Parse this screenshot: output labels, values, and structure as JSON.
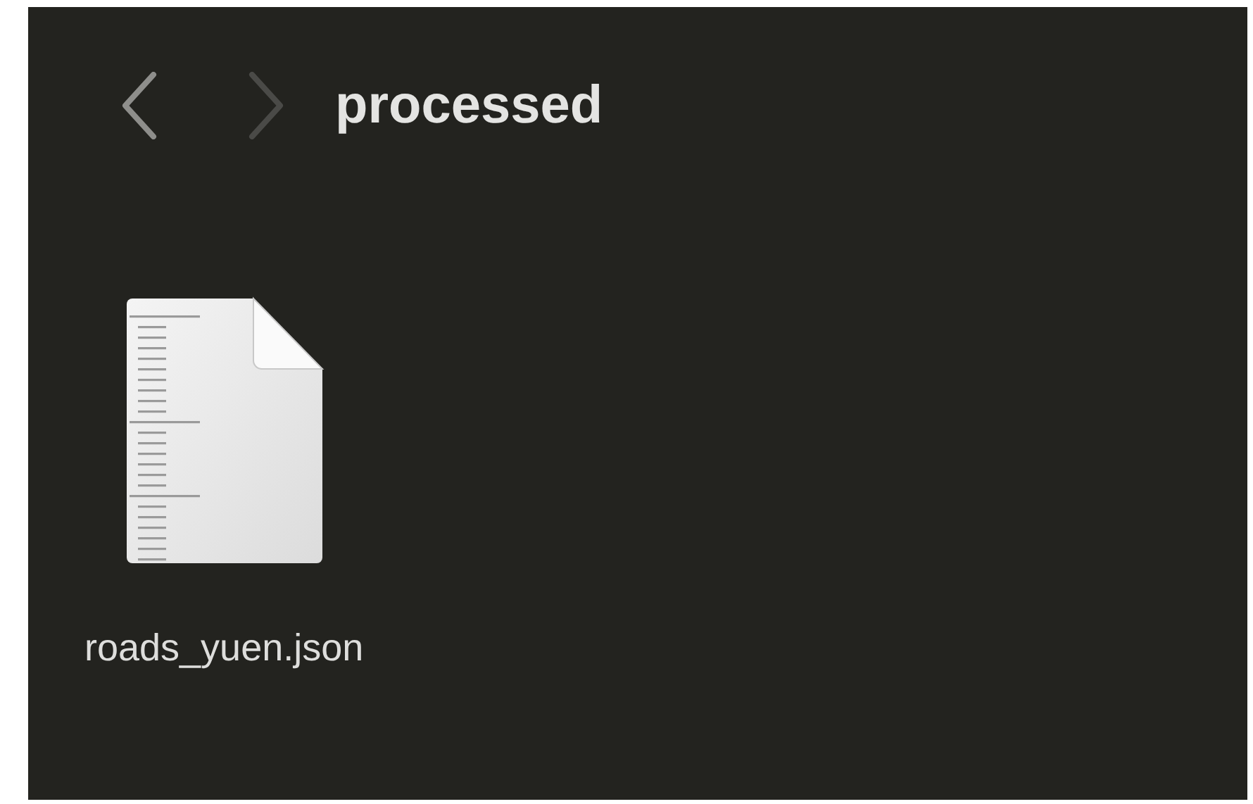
{
  "toolbar": {
    "back": {
      "disabled": false
    },
    "forward": {
      "disabled": true
    },
    "title": "processed"
  },
  "files": [
    {
      "name": "roads_yuen.json"
    }
  ]
}
